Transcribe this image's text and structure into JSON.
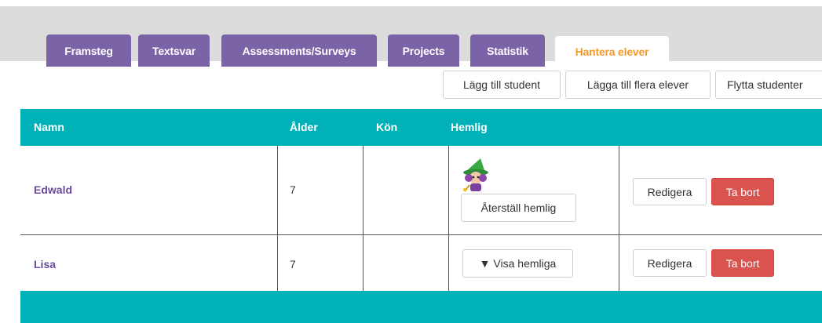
{
  "tabs": [
    {
      "label": "Framsteg"
    },
    {
      "label": "Textsvar"
    },
    {
      "label": "Assessments/Surveys"
    },
    {
      "label": "Projects"
    },
    {
      "label": "Statistik"
    },
    {
      "label": "Hantera elever",
      "active": true
    }
  ],
  "toolbar": {
    "add_student": "Lägg till student",
    "add_multiple": "Lägga till flera elever",
    "move_students": "Flytta studenter"
  },
  "table": {
    "headers": {
      "name": "Namn",
      "age": "Ålder",
      "gender": "Kön",
      "secret": "Hemlig"
    },
    "rows": [
      {
        "name": "Edwald",
        "age": "7",
        "gender": "",
        "secret_icon": "wizard-avatar-icon",
        "secret_action": "Återställ hemlig",
        "edit": "Redigera",
        "delete": "Ta bort"
      },
      {
        "name": "Lisa",
        "age": "7",
        "gender": "",
        "secret_action": "▼ Visa hemliga",
        "edit": "Redigera",
        "delete": "Ta bort"
      }
    ]
  },
  "colors": {
    "tab_bg": "#7b63a8",
    "tab_active_text": "#f39a2b",
    "table_header": "#00b1b7",
    "name_link": "#6a4a9a",
    "danger": "#d9534f"
  }
}
